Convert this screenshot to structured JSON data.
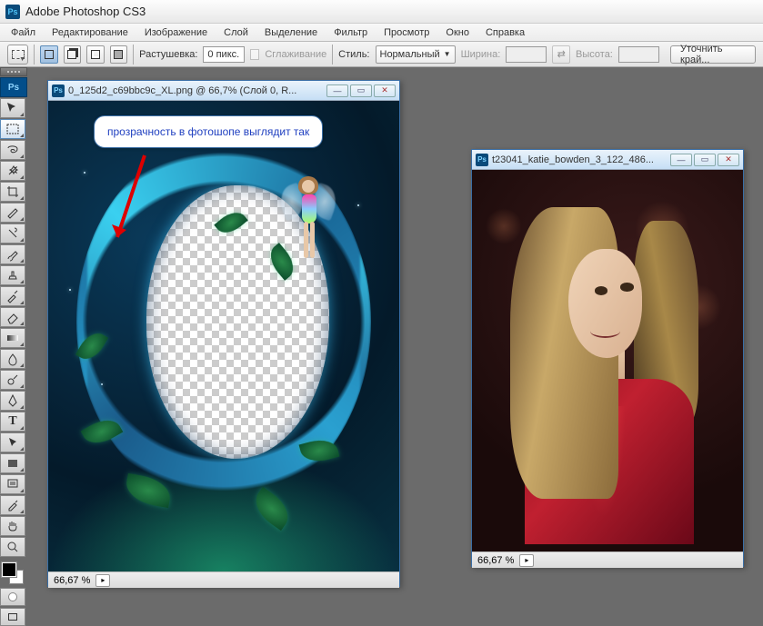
{
  "app": {
    "title": "Adobe Photoshop CS3",
    "logo": "Ps"
  },
  "menu": {
    "file": "Файл",
    "edit": "Редактирование",
    "image": "Изображение",
    "layer": "Слой",
    "select": "Выделение",
    "filter": "Фильтр",
    "view": "Просмотр",
    "window": "Окно",
    "help": "Справка"
  },
  "options": {
    "feather_label": "Растушевка:",
    "feather_value": "0 пикс.",
    "antialias": "Сглаживание",
    "style_label": "Стиль:",
    "style_value": "Нормальный",
    "width_label": "Ширина:",
    "width_value": "",
    "height_label": "Высота:",
    "height_value": "",
    "refine": "Уточнить край..."
  },
  "doc1": {
    "title": "0_125d2_c69bbc9c_XL.png @ 66,7% (Слой 0, R...",
    "zoom": "66,67 %",
    "callout": "прозрачность в фотошопе выглядит так"
  },
  "doc2": {
    "title": "t23041_katie_bowden_3_122_486...",
    "zoom": "66,67 %"
  },
  "tools": {
    "ps": "Ps",
    "move": "move-tool",
    "marquee": "rectangular-marquee-tool",
    "lasso": "lasso-tool",
    "wand": "magic-wand-tool",
    "crop": "crop-tool",
    "slice": "slice-tool",
    "heal": "spot-healing-brush-tool",
    "brush": "brush-tool",
    "stamp": "clone-stamp-tool",
    "history": "history-brush-tool",
    "eraser": "eraser-tool",
    "gradient": "gradient-tool",
    "blur": "blur-tool",
    "dodge": "dodge-tool",
    "pen": "pen-tool",
    "type": "horizontal-type-tool",
    "path": "path-selection-tool",
    "shape": "rectangle-tool",
    "notes": "notes-tool",
    "eyedrop": "eyedropper-tool",
    "hand": "hand-tool",
    "zoom": "zoom-tool"
  }
}
